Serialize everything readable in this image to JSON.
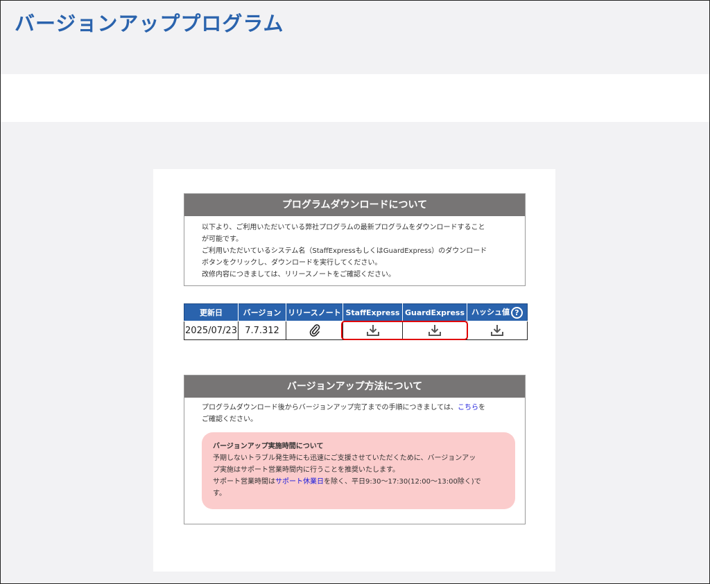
{
  "page": {
    "title": "バージョンアッププログラム"
  },
  "download_section": {
    "heading": "プログラムダウンロードについて",
    "lines": [
      "以下より、ご利用いただいている弊社プログラムの最新プログラムをダウンロードすること",
      "が可能です。",
      "ご利用いただいているシステム名（StaffExpressもしくはGuardExpress）のダウンロード",
      "ボタンをクリックし、ダウンロードを実行してください。",
      "改修内容につきましては、リリースノートをご確認ください。"
    ]
  },
  "table": {
    "headers": {
      "date": "更新日",
      "version": "バージョン",
      "release_note": "リリースノート",
      "staff": "StaffExpress",
      "guard": "GuardExpress",
      "hash": "ハッシュ値",
      "help": "?"
    },
    "row": {
      "date": "2025/07/23",
      "version": "7.7.312"
    },
    "icons": {
      "release_note": "paperclip-icon",
      "staff": "download-icon",
      "guard": "download-icon",
      "hash": "download-icon"
    }
  },
  "upgrade_section": {
    "heading": "バージョンアップ方法について",
    "intro_text": "プログラムダウンロード後からバージョンアップ完了までの手順につきましては、",
    "intro_link": "こちら",
    "intro_suffix": "を",
    "intro_line2": "ご確認ください。",
    "notice": {
      "title": "バージョンアップ実施時間について",
      "line1": "予期しないトラブル発生時にも迅速にご支援させていただくために、バージョンアッ",
      "line2": "プ実施はサポート営業時間内に行うことを推奨いたします。",
      "line3_prefix": "サポート営業時間は",
      "line3_link": "サポート休業日",
      "line3_suffix": "を除く、平日9:30～17:30(12:00～13:00除く)で",
      "line4": "す。"
    }
  },
  "colors": {
    "title_blue": "#2a63ad",
    "header_blue": "#2a63ad",
    "section_gray": "#777575",
    "notice_pink": "#fbcccc",
    "highlight_red": "#e00000",
    "link_blue": "#1a1adc"
  }
}
